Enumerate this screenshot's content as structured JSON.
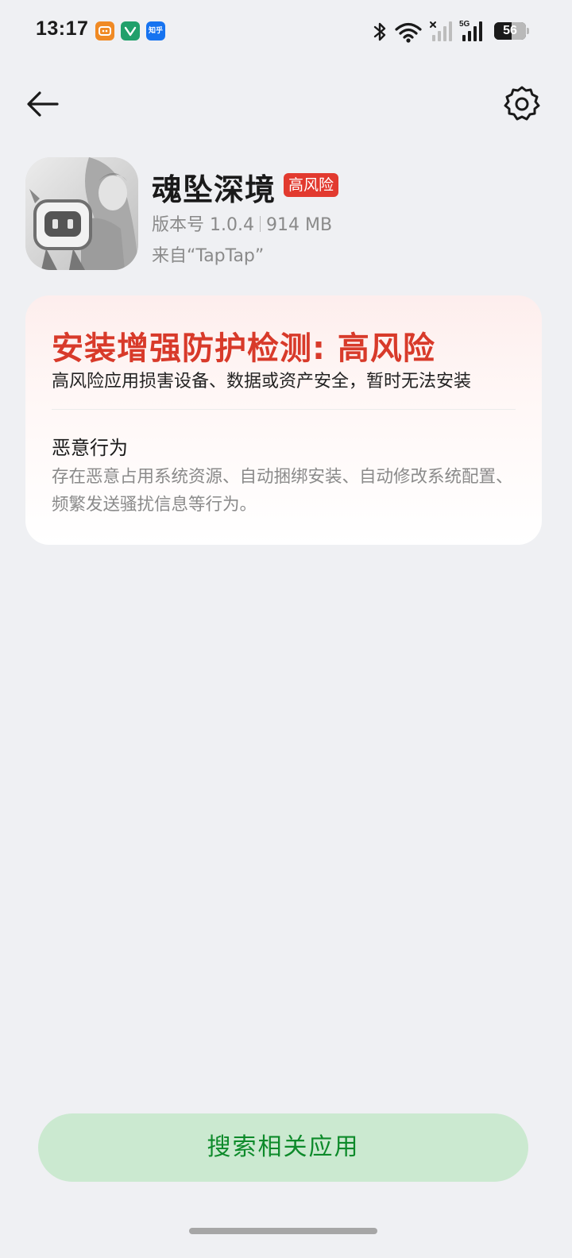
{
  "status_bar": {
    "time": "13:17",
    "notification_icons": [
      "app-notification-icon",
      "app-notification-icon",
      "知乎"
    ],
    "network_label": "5G",
    "battery_level": "56",
    "battery_fraction": 0.56
  },
  "nav": {
    "back_icon": "arrow-left-icon",
    "settings_icon": "gear-icon"
  },
  "app": {
    "name": "魂坠深境",
    "risk_badge": "高风险",
    "version": "版本号 1.0.4",
    "size": "914 MB",
    "source": "来自“TapTap”"
  },
  "risk_card": {
    "title": "安装增强防护检测: 高风险",
    "description": "高风险应用损害设备、数据或资产安全，暂时无法安装",
    "behavior_title": "恶意行为",
    "behavior_description": "存在恶意占用系统资源、自动捆绑安装、自动修改系统配置、频繁发送骚扰信息等行为。"
  },
  "actions": {
    "search_related": "搜索相关应用"
  },
  "colors": {
    "danger": "#d83a2a",
    "badge": "#e23a2f",
    "button_bg": "#cbe9d0",
    "button_text": "#0d8a2a",
    "page_bg": "#eff0f3"
  }
}
